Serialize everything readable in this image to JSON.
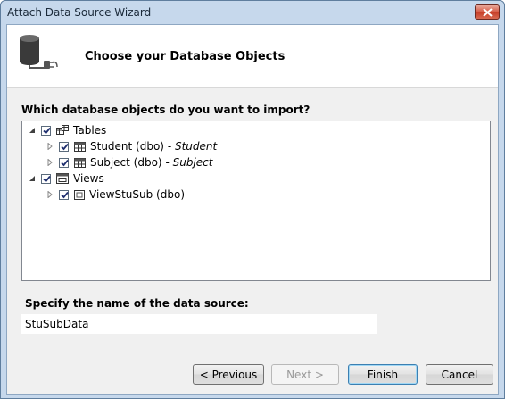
{
  "window": {
    "title": "Attach Data Source Wizard"
  },
  "header": {
    "title": "Choose your Database Objects",
    "icon": "database-icon"
  },
  "objects_section": {
    "label": "Which database objects do you want to import?"
  },
  "tree": {
    "tables": {
      "label": "Tables",
      "checked": true,
      "items": [
        {
          "label": "Student (dbo)",
          "alias": "Student",
          "checked": true
        },
        {
          "label": "Subject (dbo)",
          "alias": "Subject",
          "checked": true
        }
      ]
    },
    "views": {
      "label": "Views",
      "checked": true,
      "items": [
        {
          "label": "ViewStuSub (dbo)",
          "checked": true
        }
      ]
    }
  },
  "name_section": {
    "label": "Specify the name of the data source:",
    "value": "StuSubData"
  },
  "buttons": {
    "previous": "< Previous",
    "next": "Next >",
    "finish": "Finish",
    "cancel": "Cancel"
  }
}
